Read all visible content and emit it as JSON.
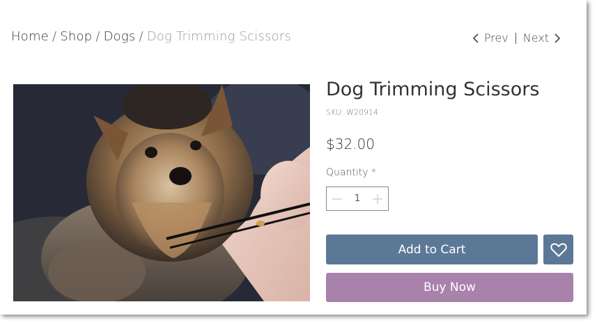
{
  "breadcrumb": {
    "items": [
      "Home",
      "Shop",
      "Dogs"
    ],
    "separator": "/",
    "current": "Dog Trimming Scissors"
  },
  "pager": {
    "prev_label": "Prev",
    "next_label": "Next"
  },
  "product": {
    "title": "Dog Trimming Scissors",
    "sku": "SKU: W20914",
    "price": "$32.00",
    "image_alt": "Yorkshire terrier being groomed with scissors"
  },
  "quantity": {
    "label": "Quantity *",
    "value": "1"
  },
  "actions": {
    "add_to_cart": "Add to Cart",
    "buy_now": "Buy Now",
    "wishlist_icon": "heart-icon"
  },
  "colors": {
    "add_to_cart_bg": "#5b7897",
    "buy_now_bg": "#a882aa",
    "breadcrumb_current": "#9a9a9a"
  }
}
